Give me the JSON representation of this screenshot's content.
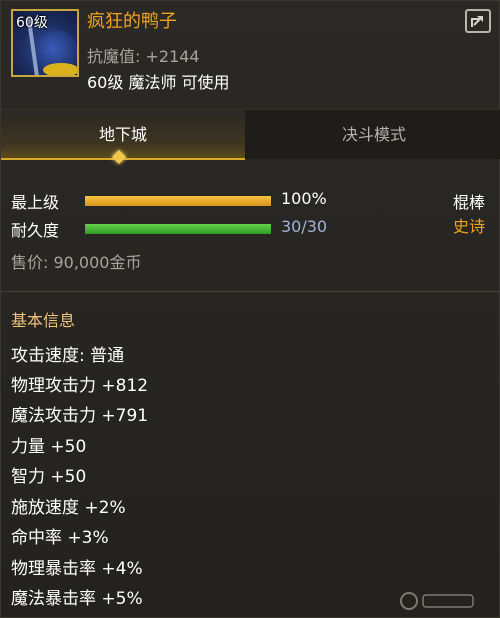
{
  "item": {
    "level_badge": "60级",
    "name": "疯狂的鸭子",
    "resist": "抗魔值: +2144",
    "requirement": "60级 魔法师 可使用",
    "weapon_type": "棍棒",
    "rarity": "史诗",
    "price": "售价: 90,000金币"
  },
  "tabs": [
    {
      "label": "地下城",
      "active": true
    },
    {
      "label": "决斗模式",
      "active": false
    }
  ],
  "stats": {
    "upgrade": {
      "label": "最上级",
      "value_text": "100%",
      "fraction": 1.0
    },
    "durability": {
      "label": "耐久度",
      "value_text": "30/30",
      "fraction": 1.0
    }
  },
  "basic_info": {
    "title": "基本信息",
    "lines": [
      "攻击速度: 普通",
      "物理攻击力 +812",
      "魔法攻击力 +791",
      "力量 +50",
      "智力 +50",
      "施放速度 +2%",
      "命中率 +3%",
      "物理暴击率 +4%",
      "魔法暴击率 +5%"
    ]
  },
  "colors": {
    "gold_text": "#f1a31f",
    "upgrade_bar": "#f7c443",
    "durability_bar": "#4cbf3a",
    "durability_text": "#9fb4d8"
  },
  "icons": {
    "share": "share-arrow-icon",
    "item": "duck-weapon-icon"
  }
}
